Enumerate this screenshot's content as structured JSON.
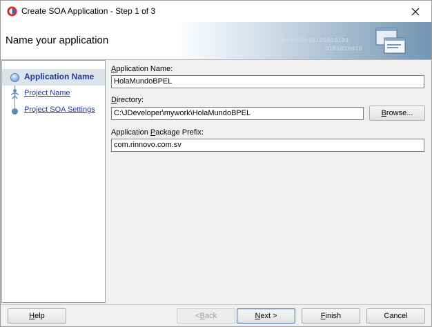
{
  "window": {
    "title": "Create SOA Application - Step 1 of 3"
  },
  "banner": {
    "title": "Name your application",
    "binary_line_1": "010101010101010101010101",
    "binary_line_2": "0101010010"
  },
  "nav": {
    "items": [
      {
        "label": "Application Name",
        "active": true
      },
      {
        "label": "Project Name",
        "active": false
      },
      {
        "label": "Project SOA Settings",
        "active": false
      }
    ]
  },
  "form": {
    "app_name": {
      "label_pre": "",
      "label_mn": "A",
      "label_post": "pplication Name:",
      "value": "HolaMundoBPEL"
    },
    "directory": {
      "label_pre": "",
      "label_mn": "D",
      "label_post": "irectory:",
      "value": "C:\\JDeveloper\\mywork\\HolaMundoBPEL"
    },
    "browse": {
      "label_pre": "",
      "label_mn": "B",
      "label_post": "rowse..."
    },
    "package": {
      "label_pre": "Application ",
      "label_mn": "P",
      "label_post": "ackage Prefix:",
      "value": "com.rinnovo.com.sv"
    }
  },
  "footer": {
    "help": {
      "pre": "",
      "mn": "H",
      "post": "elp"
    },
    "back": {
      "pre": "< ",
      "mn": "B",
      "post": "ack"
    },
    "next": {
      "pre": "",
      "mn": "N",
      "post": "ext >"
    },
    "finish": {
      "pre": "",
      "mn": "F",
      "post": "inish"
    },
    "cancel": {
      "pre": "",
      "mn": "",
      "post": "Cancel"
    }
  },
  "colors": {
    "accent": "#1f3a93",
    "banner_gradient_end": "#7395b2"
  },
  "icons": {
    "app": "oracle-app-icon",
    "close": "close-icon",
    "banner": "wizard-windows-icon"
  }
}
